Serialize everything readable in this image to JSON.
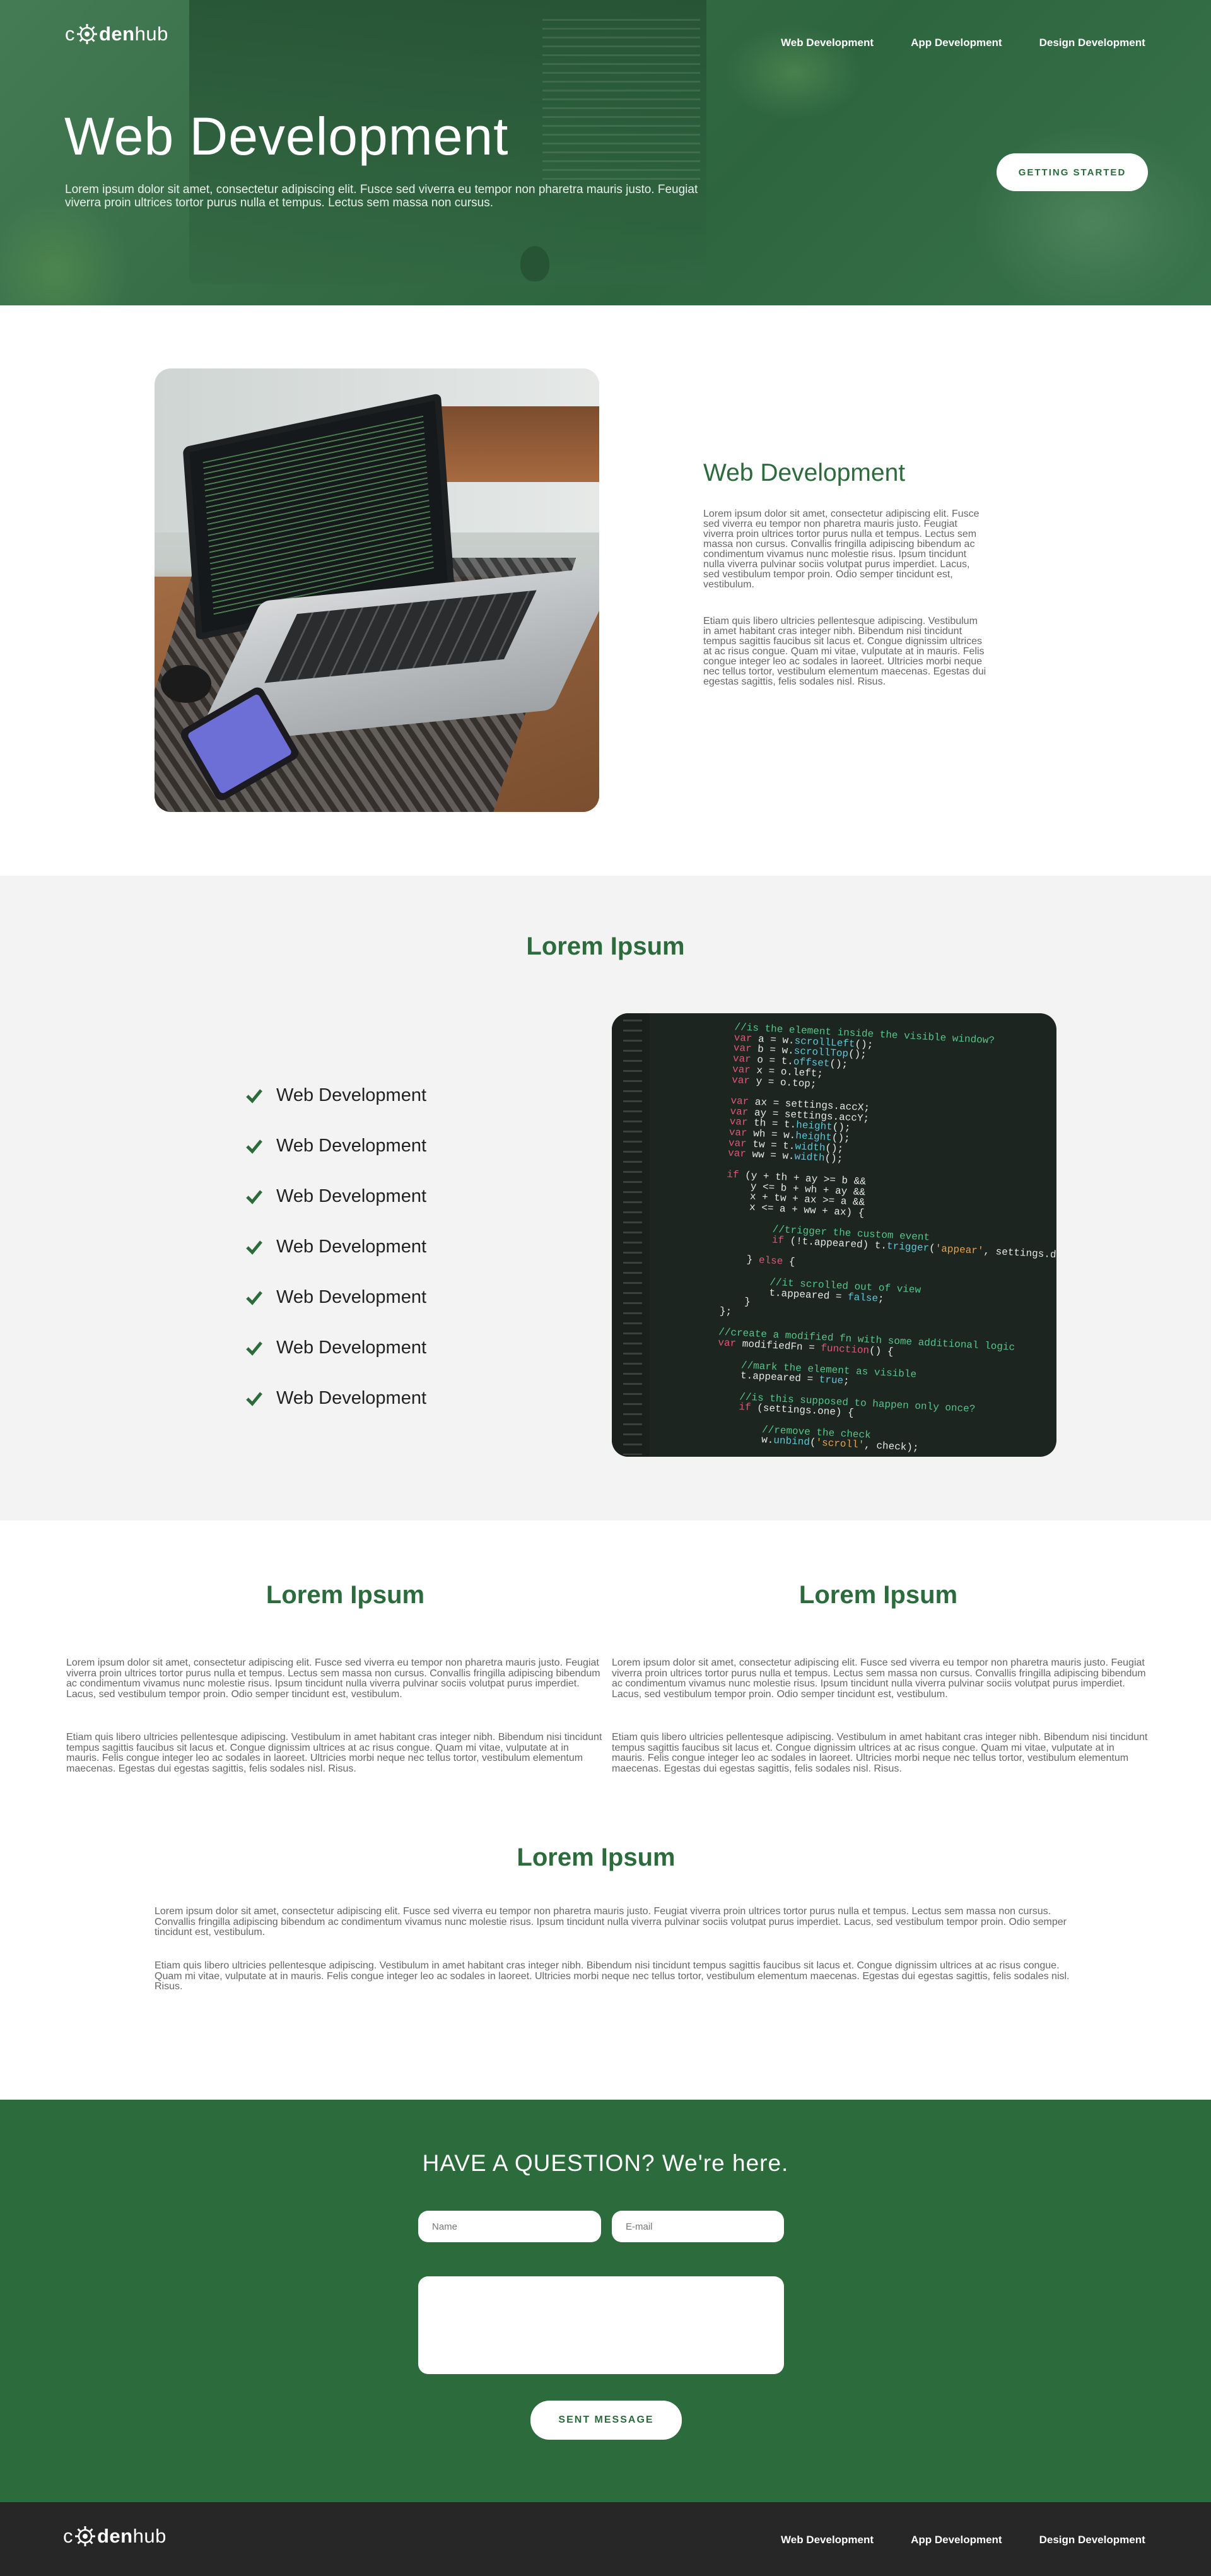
{
  "brand": {
    "logo_prefix": "c",
    "logo_bold": "den",
    "logo_suffix": "hub"
  },
  "nav": [
    "Web Development",
    "App Development",
    "Design Development"
  ],
  "hero": {
    "title": "Web Development",
    "lead": "Lorem ipsum dolor sit amet, consectetur adipiscing elit. Fusce sed viverra eu tempor non pharetra mauris justo. Feugiat viverra proin ultrices tortor purus nulla et tempus. Lectus sem massa non cursus.",
    "cta": "GETTING STARTED"
  },
  "intro": {
    "title": "Web Development",
    "p1": "Lorem ipsum dolor sit amet, consectetur adipiscing elit. Fusce sed viverra eu tempor non pharetra mauris justo. Feugiat viverra proin ultrices tortor purus nulla et tempus. Lectus sem massa non cursus. Convallis fringilla adipiscing bibendum ac condimentum vivamus nunc molestie risus. Ipsum tincidunt nulla viverra pulvinar sociis volutpat purus imperdiet. Lacus, sed vestibulum tempor proin. Odio semper tincidunt est, vestibulum.",
    "p2": "Etiam quis libero ultricies pellentesque adipiscing. Vestibulum in amet habitant cras integer nibh. Bibendum nisi tincidunt tempus sagittis faucibus sit lacus et. Congue dignissim ultrices at ac risus congue. Quam mi vitae, vulputate at in mauris. Felis congue integer leo ac sodales in laoreet. Ultricies morbi neque nec tellus tortor, vestibulum elementum maecenas. Egestas dui egestas sagittis, felis sodales nisl. Risus."
  },
  "features": {
    "title": "Lorem Ipsum",
    "items": [
      "Web Development",
      "Web Development",
      "Web Development",
      "Web Development",
      "Web Development",
      "Web Development",
      "Web Development"
    ]
  },
  "columns": [
    {
      "title": "Lorem Ipsum",
      "p1": "Lorem ipsum dolor sit amet, consectetur adipiscing elit. Fusce sed viverra eu tempor non pharetra mauris justo. Feugiat viverra proin ultrices tortor purus nulla et tempus. Lectus sem massa non cursus. Convallis fringilla adipiscing bibendum ac condimentum vivamus nunc molestie risus. Ipsum tincidunt nulla viverra pulvinar sociis volutpat purus imperdiet. Lacus, sed vestibulum tempor proin. Odio semper tincidunt est, vestibulum.",
      "p2": "Etiam quis libero ultricies pellentesque adipiscing. Vestibulum in amet habitant cras integer nibh. Bibendum nisi tincidunt tempus sagittis faucibus sit lacus et. Congue dignissim ultrices at ac risus congue. Quam mi vitae, vulputate at in mauris. Felis congue integer leo ac sodales in laoreet. Ultricies morbi neque nec tellus tortor, vestibulum elementum maecenas. Egestas dui egestas sagittis, felis sodales nisl. Risus."
    },
    {
      "title": "Lorem Ipsum",
      "p1": "Lorem ipsum dolor sit amet, consectetur adipiscing elit. Fusce sed viverra eu tempor non pharetra mauris justo. Feugiat viverra proin ultrices tortor purus nulla et tempus. Lectus sem massa non cursus. Convallis fringilla adipiscing bibendum ac condimentum vivamus nunc molestie risus. Ipsum tincidunt nulla viverra pulvinar sociis volutpat purus imperdiet. Lacus, sed vestibulum tempor proin. Odio semper tincidunt est, vestibulum.",
      "p2": "Etiam quis libero ultricies pellentesque adipiscing. Vestibulum in amet habitant cras integer nibh. Bibendum nisi tincidunt tempus sagittis faucibus sit lacus et. Congue dignissim ultrices at ac risus congue. Quam mi vitae, vulputate at in mauris. Felis congue integer leo ac sodales in laoreet. Ultricies morbi neque nec tellus tortor, vestibulum elementum maecenas. Egestas dui egestas sagittis, felis sodales nisl. Risus."
    }
  ],
  "center": {
    "title": "Lorem Ipsum",
    "p1": "Lorem ipsum dolor sit amet, consectetur adipiscing elit. Fusce sed viverra eu tempor non pharetra mauris justo. Feugiat viverra proin ultrices tortor purus nulla et tempus. Lectus sem massa non cursus. Convallis fringilla adipiscing bibendum ac condimentum vivamus nunc molestie risus. Ipsum tincidunt nulla viverra pulvinar sociis volutpat purus imperdiet. Lacus, sed vestibulum tempor proin. Odio semper tincidunt est, vestibulum.",
    "p2": "Etiam quis libero ultricies pellentesque adipiscing. Vestibulum in amet habitant cras integer nibh. Bibendum nisi tincidunt tempus sagittis faucibus sit lacus et. Congue dignissim ultrices at ac risus congue. Quam mi vitae, vulputate at in mauris. Felis congue integer leo ac sodales in laoreet. Ultricies morbi neque nec tellus tortor, vestibulum elementum maecenas. Egestas dui egestas sagittis, felis sodales nisl. Risus."
  },
  "contact": {
    "title": "HAVE A QUESTION? We're here.",
    "name_placeholder": "Name",
    "email_placeholder": "E-mail",
    "message_placeholder": "",
    "submit": "SENT MESSAGE"
  },
  "colors": {
    "brand_green": "#2b6b3c",
    "footer_bg": "#272727",
    "section_grey": "#f3f3f3"
  },
  "icons": {
    "logo_mark": "gear-globe-icon",
    "list_bullet": "checkmark-icon"
  }
}
